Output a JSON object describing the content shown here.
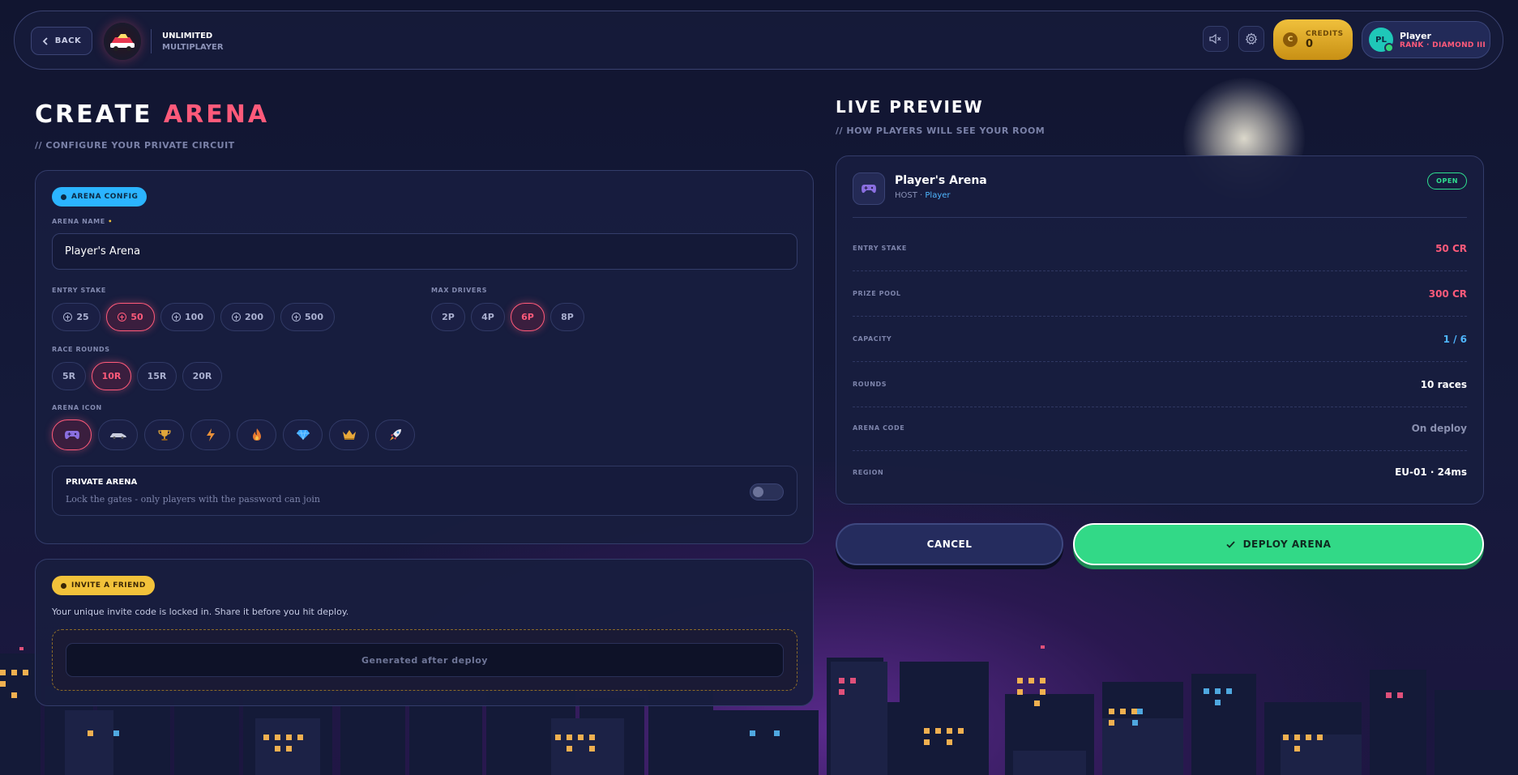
{
  "header": {
    "back_label": "BACK",
    "brand_line1": "UNLIMITED",
    "brand_line2": "MULTIPLAYER",
    "credits_label": "CREDITS",
    "credits_value": "0",
    "coin_glyph": "C",
    "player_initials": "PL",
    "player_name": "Player",
    "player_rank": "RANK · DIAMOND III"
  },
  "create": {
    "title_word1": "CREATE",
    "title_word2": "ARENA",
    "subtitle": "// CONFIGURE YOUR PRIVATE CIRCUIT"
  },
  "config": {
    "badge": "ARENA CONFIG",
    "name_label": "ARENA NAME",
    "name_value": "Player's Arena",
    "stake_label": "ENTRY STAKE",
    "stakes": [
      "25",
      "50",
      "100",
      "200",
      "500"
    ],
    "selected_stake": "50",
    "drivers_label": "MAX DRIVERS",
    "drivers": [
      "2P",
      "4P",
      "6P",
      "8P"
    ],
    "selected_drivers": "6P",
    "rounds_label": "RACE ROUNDS",
    "rounds": [
      "5R",
      "10R",
      "15R",
      "20R"
    ],
    "selected_rounds": "10R",
    "icon_label": "ARENA ICON",
    "icons": [
      "gamepad-icon",
      "car-icon",
      "trophy-icon",
      "lightning-icon",
      "flame-icon",
      "diamond-icon",
      "crown-icon",
      "rocket-icon"
    ],
    "selected_icon": "gamepad-icon",
    "private_title": "PRIVATE ARENA",
    "private_desc": "Lock the gates - only players with the password can join",
    "private_enabled": false
  },
  "invite": {
    "badge": "INVITE A FRIEND",
    "description": "Your unique invite code is locked in. Share it before you hit deploy.",
    "code_placeholder": "Generated after deploy"
  },
  "preview": {
    "title": "LIVE PREVIEW",
    "subtitle": "// HOW PLAYERS WILL SEE YOUR ROOM",
    "room_name": "Player's Arena",
    "host_prefix": "HOST · ",
    "host_name": "Player",
    "status": "OPEN",
    "rows": [
      {
        "key": "ENTRY STAKE",
        "value": "50 CR",
        "color": "#ff5a7a"
      },
      {
        "key": "PRIZE POOL",
        "value": "300 CR",
        "color": "#ff5a7a"
      },
      {
        "key": "CAPACITY",
        "value": "1 / 6",
        "color": "#4fb6ff"
      },
      {
        "key": "ROUNDS",
        "value": "10 races",
        "color": "#ffffff"
      },
      {
        "key": "ARENA CODE",
        "value": "On deploy",
        "color": "#8a90b0"
      },
      {
        "key": "REGION",
        "value": "EU-01 · 24ms",
        "color": "#ffffff"
      }
    ]
  },
  "actions": {
    "cancel_label": "CANCEL",
    "deploy_label": "DEPLOY ARENA"
  },
  "colors": {
    "accent_pink": "#ff5a7a",
    "accent_green": "#32d987",
    "accent_cyan": "#2bb4ff",
    "accent_gold": "#f2c23a"
  }
}
